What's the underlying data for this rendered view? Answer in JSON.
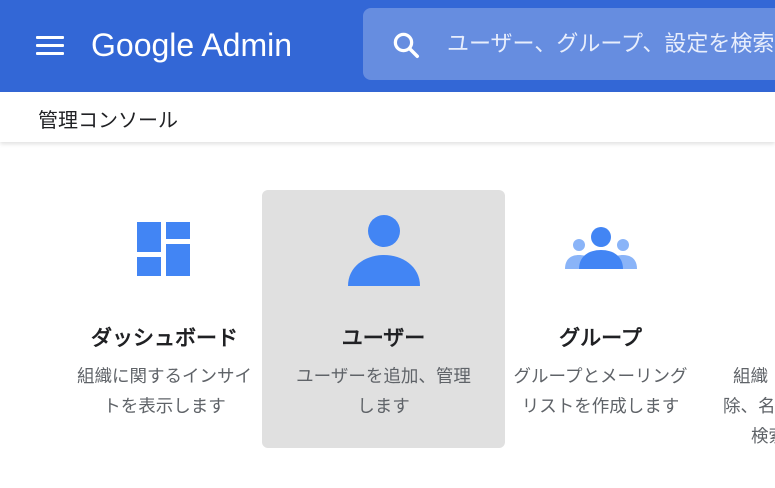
{
  "header": {
    "brand_google": "Google",
    "brand_admin": "Admin",
    "search_placeholder": "ユーザー、グループ、設定を検索",
    "background_color": "#3367d6",
    "icons": [
      "menu-icon",
      "search-icon"
    ]
  },
  "subheader": {
    "title": "管理コンソール"
  },
  "cards": [
    {
      "title": "ダッシュボード",
      "desc_line1": "組織に関するインサイ",
      "desc_line2": "トを表示します",
      "icon": "dashboard-icon"
    },
    {
      "title": "ユーザー",
      "desc_line1": "ユーザーを追加、管理",
      "desc_line2": "します",
      "icon": "person-icon"
    },
    {
      "title": "グループ",
      "desc_line1": "グループとメーリング",
      "desc_line2": "リストを作成します",
      "icon": "group-icon"
    },
    {
      "title": "",
      "desc_line1": "組織",
      "desc_line2": "除、名",
      "desc_line3": "検索",
      "icon": ""
    }
  ],
  "accent_color": "#4285f4"
}
